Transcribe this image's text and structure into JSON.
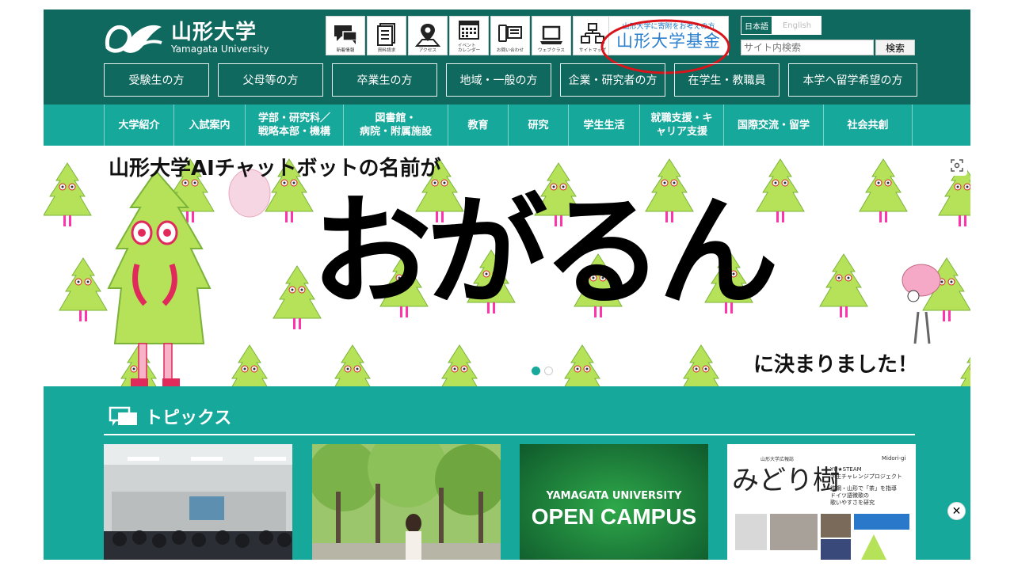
{
  "header": {
    "logo_ja": "山形大学",
    "logo_en": "Yamagata University",
    "icons": [
      {
        "label": "新着情報",
        "icon": "chat-bubbles-icon"
      },
      {
        "label": "資料請求",
        "icon": "documents-icon"
      },
      {
        "label": "アクセス",
        "icon": "map-pin-icon"
      },
      {
        "label": "イベント\nカレンダー",
        "icon": "calendar-icon"
      },
      {
        "label": "お問い合わせ",
        "icon": "phone-contact-icon"
      },
      {
        "label": "ウェブクラス",
        "icon": "laptop-icon"
      },
      {
        "label": "サイトマップ",
        "icon": "sitemap-icon"
      }
    ],
    "kikin_sub": "山形大学に寄附をお考えの方",
    "kikin_main": "山形大学基金",
    "lang_ja": "日本語",
    "lang_en": "English",
    "search_placeholder": "サイト内検索",
    "search_button": "検索",
    "annotation_color": "#d9141b"
  },
  "audience": [
    "受験生の方",
    "父母等の方",
    "卒業生の方",
    "地域・一般の方",
    "企業・研究者の方",
    "在学生・教職員",
    "本学へ留学希望の方"
  ],
  "mainnav": [
    "大学紹介",
    "入試案内",
    "学部・研究科／\n戦略本部・機構",
    "図書館・\n病院・附属施設",
    "教育",
    "研究",
    "学生生活",
    "就職支援・キ\nャリア支援",
    "国際交流・留学",
    "社会共創"
  ],
  "hero": {
    "title": "山形大学AIチャットボットの名前が",
    "big": "おがるん",
    "foot": "に決まりました！",
    "slide_count": 2,
    "active_slide": 1
  },
  "topics": {
    "title": "トピックス",
    "cards": [
      {
        "kind": "photo-lecture-hall"
      },
      {
        "kind": "photo-tree-avenue"
      },
      {
        "kind": "banner",
        "line1": "YAMAGATA UNIVERSITY",
        "line2": "OPEN CAMPUS"
      },
      {
        "kind": "magazine",
        "small": "山形大学広報誌",
        "brand": "Midori-gi",
        "title": "みどり樹",
        "items": [
          "YU★STEAM",
          "学生チャレンジプロジェクト",
          "鉄鋼・山形で「茶」を指導",
          "ドイツ語徴歌の",
          "歌いやすさを研究"
        ]
      }
    ]
  },
  "colors": {
    "header_bg": "#10695e",
    "nav_bg": "#17a89c",
    "accent_blue": "#2a7fcf"
  }
}
